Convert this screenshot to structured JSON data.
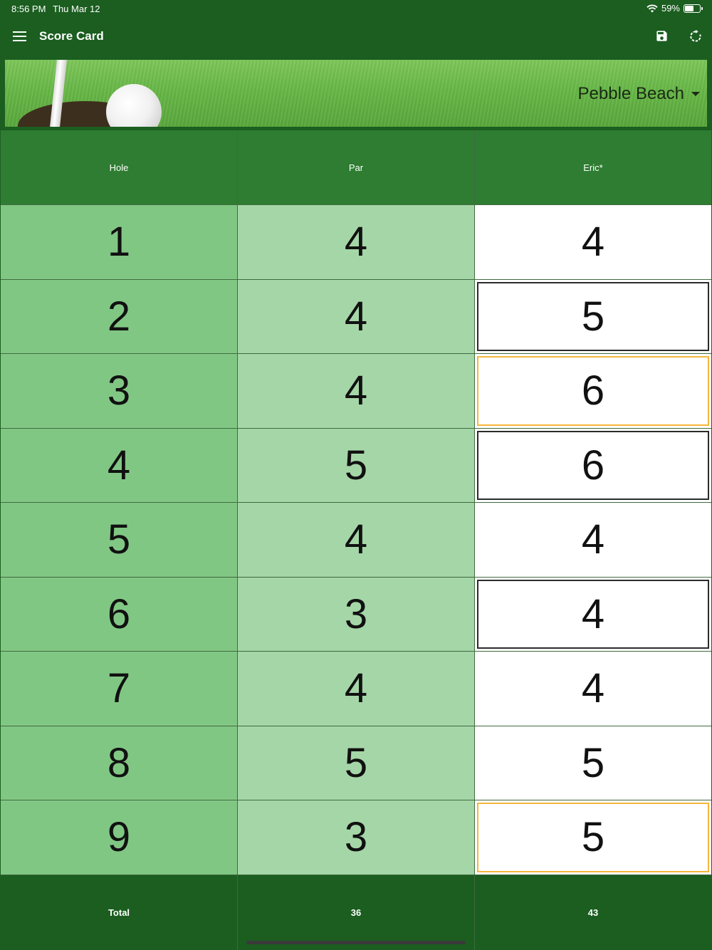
{
  "status_bar": {
    "time": "8:56 PM",
    "date": "Thu Mar 12",
    "battery": "59%",
    "battery_level": 0.59
  },
  "app_bar": {
    "title": "Score Card",
    "icons": [
      "menu-icon",
      "save-icon",
      "refresh-icon"
    ]
  },
  "banner": {
    "course": "Pebble Beach"
  },
  "table": {
    "headers": [
      "Hole",
      "Par",
      "Eric*"
    ],
    "rows": [
      {
        "hole": "1",
        "par": "4",
        "score": "4",
        "marker": "none"
      },
      {
        "hole": "2",
        "par": "4",
        "score": "5",
        "marker": "bogey"
      },
      {
        "hole": "3",
        "par": "4",
        "score": "6",
        "marker": "double-bogey"
      },
      {
        "hole": "4",
        "par": "5",
        "score": "6",
        "marker": "bogey"
      },
      {
        "hole": "5",
        "par": "4",
        "score": "4",
        "marker": "none"
      },
      {
        "hole": "6",
        "par": "3",
        "score": "4",
        "marker": "bogey"
      },
      {
        "hole": "7",
        "par": "4",
        "score": "4",
        "marker": "none"
      },
      {
        "hole": "8",
        "par": "5",
        "score": "5",
        "marker": "none"
      },
      {
        "hole": "9",
        "par": "3",
        "score": "5",
        "marker": "double-bogey"
      }
    ],
    "total": {
      "label": "Total",
      "par": "36",
      "score": "43"
    }
  },
  "colors": {
    "primary_dark": "#1b5e20",
    "header": "#2e7d32",
    "hole_col": "#81c784",
    "par_col": "#a5d6a7",
    "double_bogey_border": "#f6b63b"
  }
}
